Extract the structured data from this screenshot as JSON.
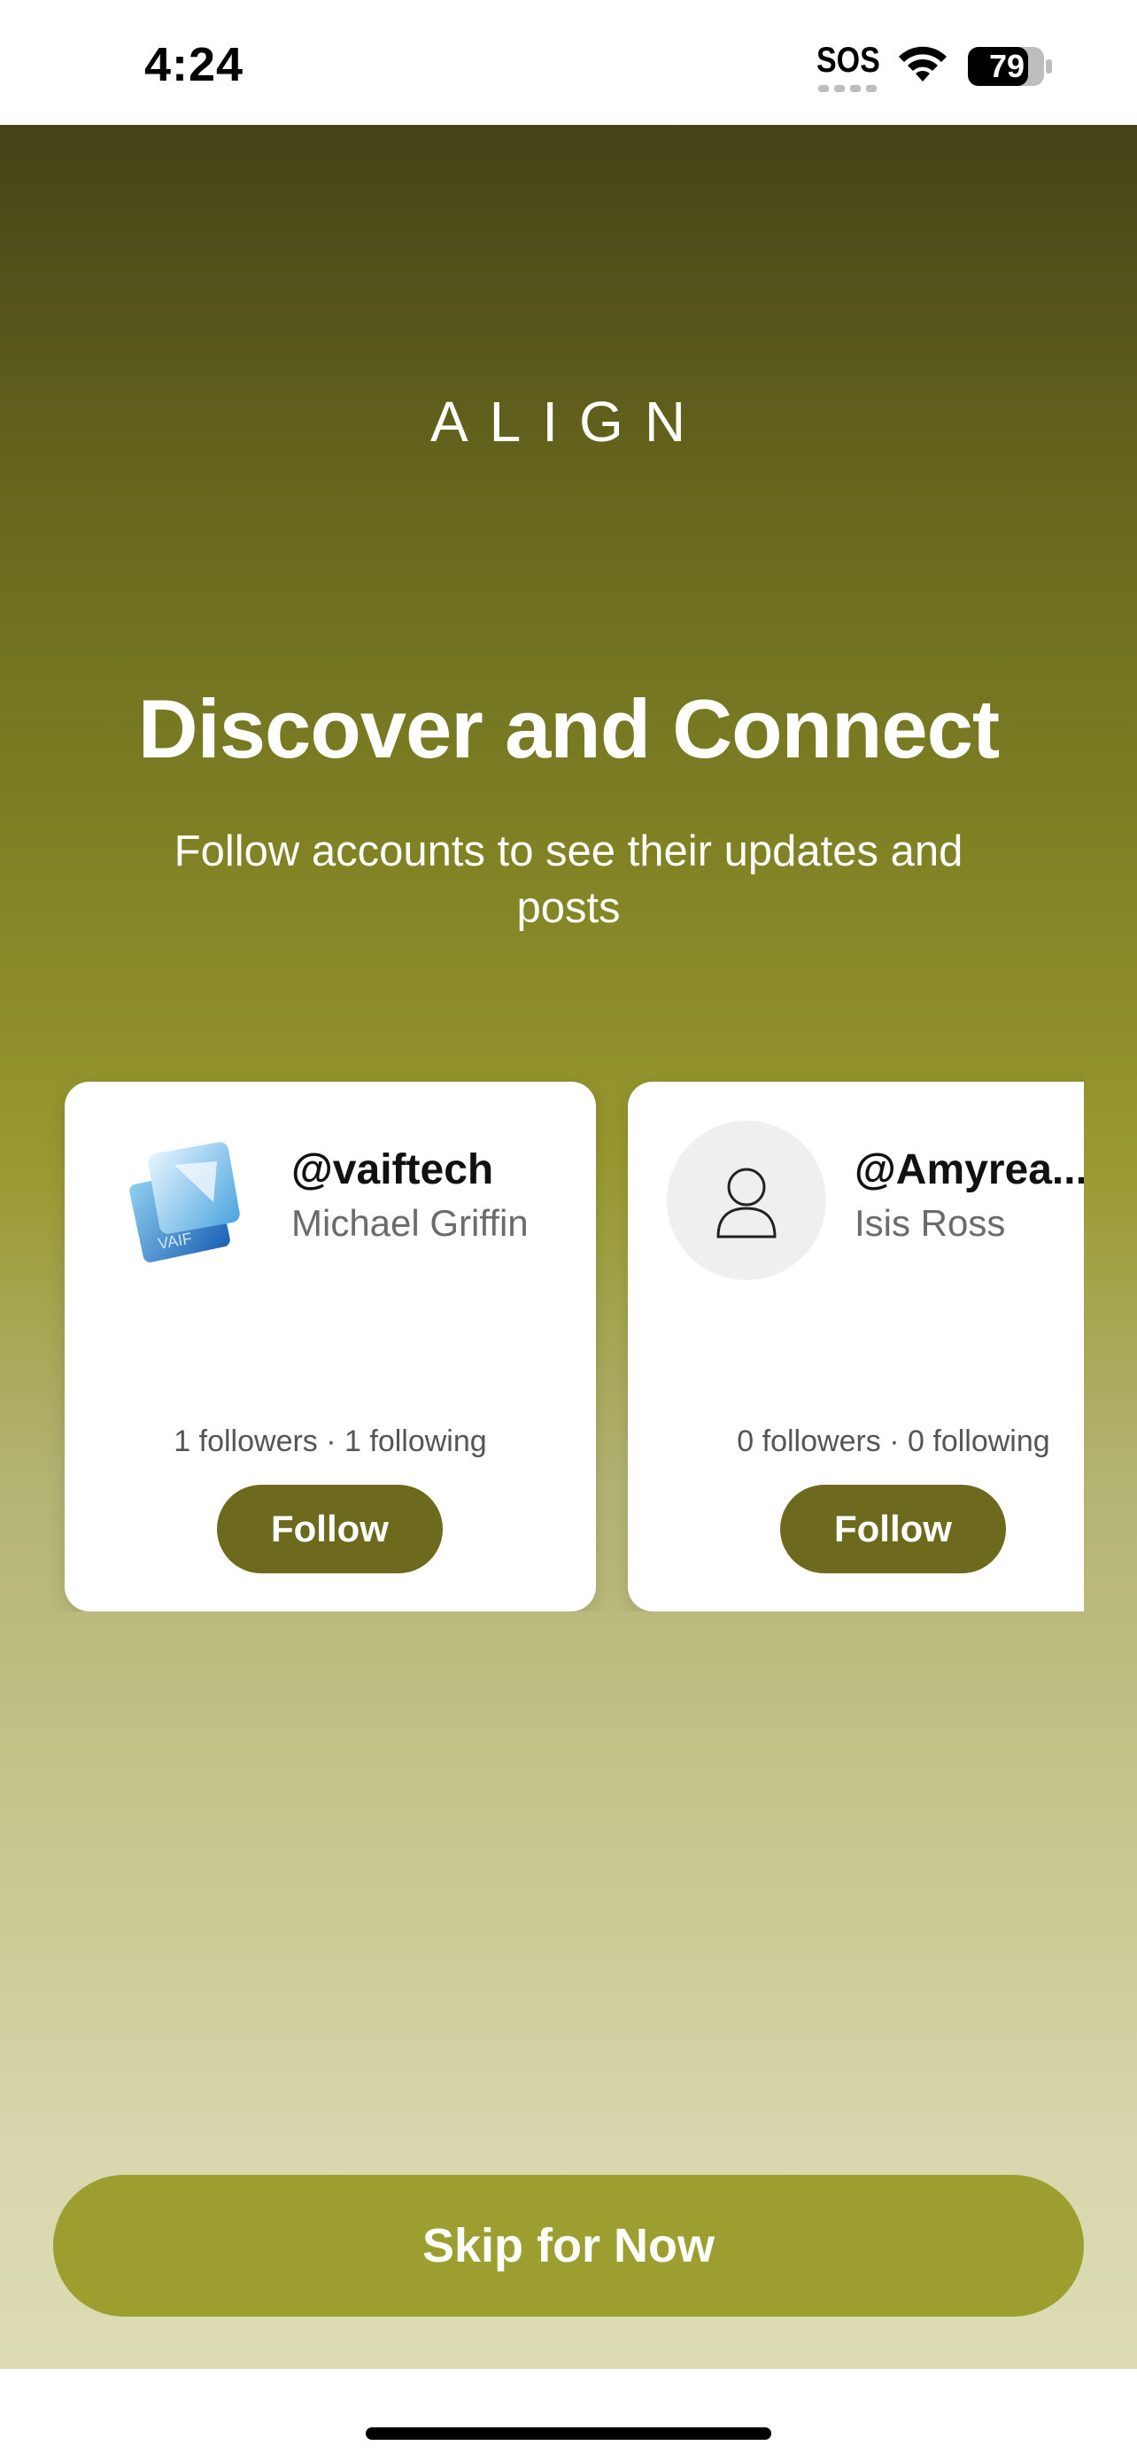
{
  "status_bar": {
    "time": "4:24",
    "sos": "SOS",
    "battery": "79",
    "icons": [
      "wifi-icon",
      "battery-icon"
    ]
  },
  "brand": {
    "logo_text": "ALIGN"
  },
  "header": {
    "title": "Discover and Connect",
    "subtitle": "Follow accounts to see their updates and posts"
  },
  "accounts": [
    {
      "handle": "@vaiftech",
      "name": "Michael Griffin",
      "avatar": "vaif-logo-icon",
      "stats": "1 followers · 1 following",
      "button": "Follow"
    },
    {
      "handle": "@Amyrea...",
      "name": "Isis Ross",
      "avatar": "user-placeholder-icon",
      "stats": "0 followers · 0 following",
      "button": "Follow"
    }
  ],
  "footer": {
    "skip_label": "Skip for Now"
  },
  "colors": {
    "gradient_top": "#454318",
    "gradient_bottom": "#dddcb3",
    "follow_button": "#6d6a1e",
    "skip_button": "#9c9f2f"
  }
}
